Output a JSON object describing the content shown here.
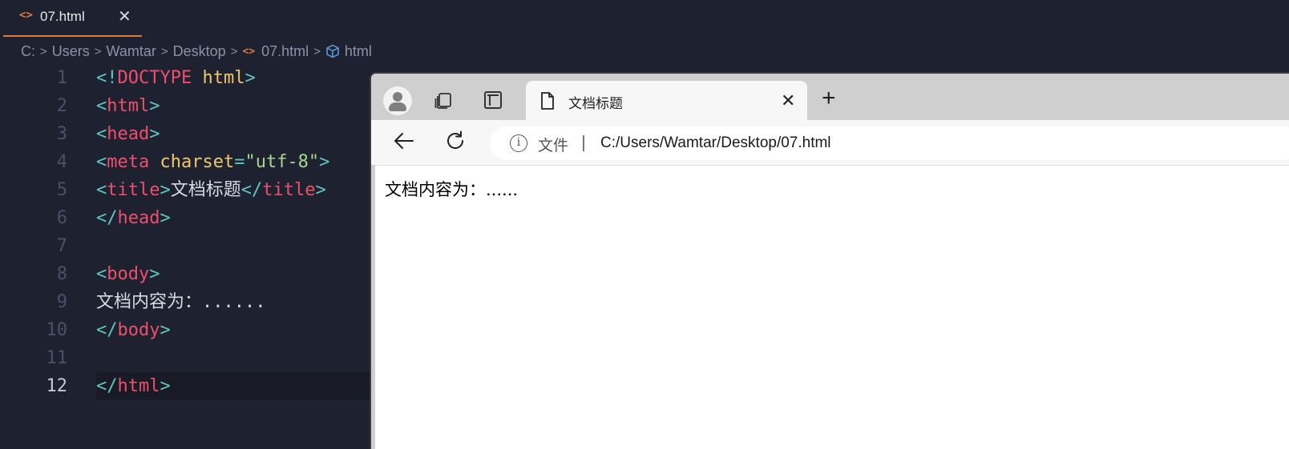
{
  "editor": {
    "tab": {
      "icon": "html-file-icon",
      "label": "07.html",
      "close": "✕"
    },
    "breadcrumb": {
      "segments": [
        "C:",
        "Users",
        "Wamtar",
        "Desktop",
        "07.html",
        "html"
      ],
      "separator": ">"
    },
    "line_numbers": [
      "1",
      "2",
      "3",
      "4",
      "5",
      "6",
      "7",
      "8",
      "9",
      "10",
      "11",
      "12"
    ],
    "active_line": "12",
    "code": {
      "l1": {
        "p1": "<!",
        "t": "DOCTYPE",
        "sp": " ",
        "a": "html",
        "p2": ">"
      },
      "l2": {
        "p1": "<",
        "t": "html",
        "p2": ">"
      },
      "l3": {
        "p1": "<",
        "t": "head",
        "p2": ">"
      },
      "l4": {
        "p1": "<",
        "t": "meta",
        "sp": " ",
        "a": "charset",
        "eq": "=",
        "s": "\"utf-8\"",
        "p2": ">"
      },
      "l5": {
        "p1": "<",
        "t": "title",
        "p2": ">",
        "txt": "文档标题",
        "p3": "</",
        "t2": "title",
        "p4": ">"
      },
      "l6": {
        "p1": "</",
        "t": "head",
        "p2": ">"
      },
      "l8": {
        "p1": "<",
        "t": "body",
        "p2": ">"
      },
      "l9": {
        "txt": "文档内容为：......"
      },
      "l10": {
        "p1": "</",
        "t": "body",
        "p2": ">"
      },
      "l12": {
        "p1": "</",
        "t": "html",
        "p2": ">"
      }
    },
    "colors": {
      "tag": "#ee4f6a",
      "punct": "#5fc7c0",
      "attr": "#f0c86a",
      "string": "#a6d98a",
      "accent": "#e07a3a"
    }
  },
  "browser": {
    "tab_title": "文档标题",
    "tab_close": "✕",
    "new_tab": "+",
    "address": {
      "scheme_label": "文件",
      "url": "C:/Users/Wamtar/Desktop/07.html"
    },
    "page_text": "文档内容为：......",
    "icons": [
      "profile-icon",
      "workspaces-icon",
      "vertical-tabs-icon",
      "page-icon",
      "back-arrow-icon",
      "reload-icon",
      "info-icon"
    ]
  }
}
